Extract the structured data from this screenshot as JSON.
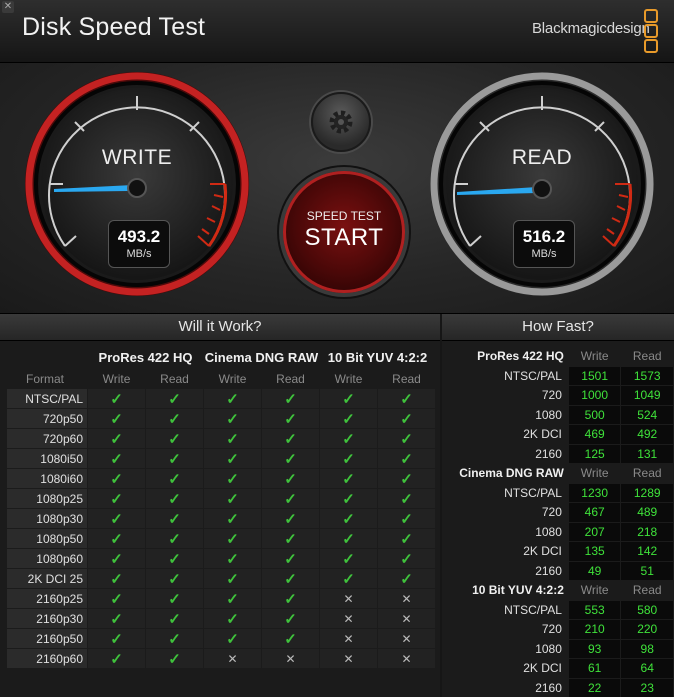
{
  "app": {
    "title": "Disk Speed Test",
    "brand": "Blackmagicdesign",
    "close_glyph": "✕"
  },
  "colors": {
    "accent_red": "#d02020",
    "needle_blue": "#2aa8f0",
    "ok_green": "#3fc23c",
    "value_green": "#3fe23a",
    "logo_orange": "#e89a2a"
  },
  "gauges": {
    "write": {
      "label": "WRITE",
      "value": "493.2",
      "unit": "MB/s"
    },
    "read": {
      "label": "READ",
      "value": "516.2",
      "unit": "MB/s"
    }
  },
  "controls": {
    "settings_icon": "gear-icon",
    "start_small": "SPEED TEST",
    "start_big": "START"
  },
  "will_it_work": {
    "title": "Will it Work?",
    "format_header": "Format",
    "write_label": "Write",
    "read_label": "Read",
    "codecs": [
      "ProRes 422 HQ",
      "Cinema DNG RAW",
      "10 Bit YUV 4:2:2"
    ],
    "rows": [
      {
        "format": "NTSC/PAL",
        "cells": [
          "✓",
          "✓",
          "✓",
          "✓",
          "✓",
          "✓"
        ]
      },
      {
        "format": "720p50",
        "cells": [
          "✓",
          "✓",
          "✓",
          "✓",
          "✓",
          "✓"
        ]
      },
      {
        "format": "720p60",
        "cells": [
          "✓",
          "✓",
          "✓",
          "✓",
          "✓",
          "✓"
        ]
      },
      {
        "format": "1080i50",
        "cells": [
          "✓",
          "✓",
          "✓",
          "✓",
          "✓",
          "✓"
        ]
      },
      {
        "format": "1080i60",
        "cells": [
          "✓",
          "✓",
          "✓",
          "✓",
          "✓",
          "✓"
        ]
      },
      {
        "format": "1080p25",
        "cells": [
          "✓",
          "✓",
          "✓",
          "✓",
          "✓",
          "✓"
        ]
      },
      {
        "format": "1080p30",
        "cells": [
          "✓",
          "✓",
          "✓",
          "✓",
          "✓",
          "✓"
        ]
      },
      {
        "format": "1080p50",
        "cells": [
          "✓",
          "✓",
          "✓",
          "✓",
          "✓",
          "✓"
        ]
      },
      {
        "format": "1080p60",
        "cells": [
          "✓",
          "✓",
          "✓",
          "✓",
          "✓",
          "✓"
        ]
      },
      {
        "format": "2K DCI 25",
        "cells": [
          "✓",
          "✓",
          "✓",
          "✓",
          "✓",
          "✓"
        ]
      },
      {
        "format": "2160p25",
        "cells": [
          "✓",
          "✓",
          "✓",
          "✓",
          "✕",
          "✕"
        ]
      },
      {
        "format": "2160p30",
        "cells": [
          "✓",
          "✓",
          "✓",
          "✓",
          "✕",
          "✕"
        ]
      },
      {
        "format": "2160p50",
        "cells": [
          "✓",
          "✓",
          "✓",
          "✓",
          "✕",
          "✕"
        ]
      },
      {
        "format": "2160p60",
        "cells": [
          "✓",
          "✓",
          "✕",
          "✕",
          "✕",
          "✕"
        ]
      }
    ]
  },
  "how_fast": {
    "title": "How Fast?",
    "write_label": "Write",
    "read_label": "Read",
    "groups": [
      {
        "codec": "ProRes 422 HQ",
        "rows": [
          {
            "format": "NTSC/PAL",
            "write": "1501",
            "read": "1573"
          },
          {
            "format": "720",
            "write": "1000",
            "read": "1049"
          },
          {
            "format": "1080",
            "write": "500",
            "read": "524"
          },
          {
            "format": "2K DCI",
            "write": "469",
            "read": "492"
          },
          {
            "format": "2160",
            "write": "125",
            "read": "131"
          }
        ]
      },
      {
        "codec": "Cinema DNG RAW",
        "rows": [
          {
            "format": "NTSC/PAL",
            "write": "1230",
            "read": "1289"
          },
          {
            "format": "720",
            "write": "467",
            "read": "489"
          },
          {
            "format": "1080",
            "write": "207",
            "read": "218"
          },
          {
            "format": "2K DCI",
            "write": "135",
            "read": "142"
          },
          {
            "format": "2160",
            "write": "49",
            "read": "51"
          }
        ]
      },
      {
        "codec": "10 Bit YUV 4:2:2",
        "rows": [
          {
            "format": "NTSC/PAL",
            "write": "553",
            "read": "580"
          },
          {
            "format": "720",
            "write": "210",
            "read": "220"
          },
          {
            "format": "1080",
            "write": "93",
            "read": "98"
          },
          {
            "format": "2K DCI",
            "write": "61",
            "read": "64"
          },
          {
            "format": "2160",
            "write": "22",
            "read": "23"
          }
        ]
      }
    ]
  }
}
